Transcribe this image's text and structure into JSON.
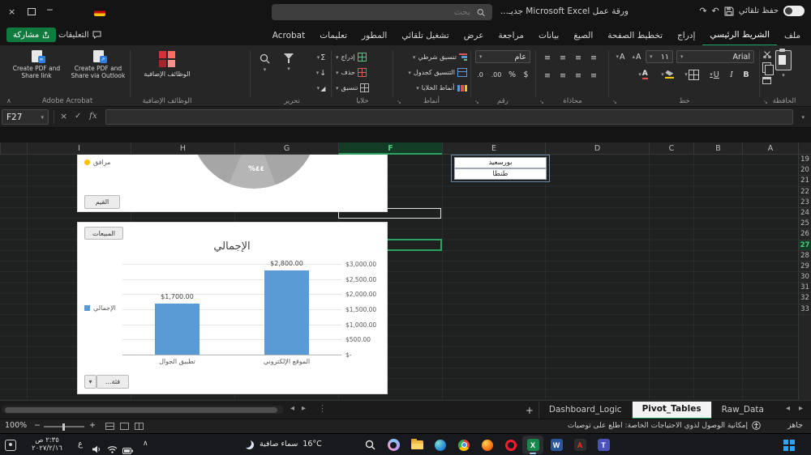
{
  "titlebar": {
    "autosave_label": "حفظ تلقائي",
    "search_placeholder": "بحث",
    "app_title": "ورقة عمل Microsoft Excel جديـ..."
  },
  "glyphs": {
    "close": "×",
    "minimize": "─",
    "dropdown": "▾",
    "dropup": "▴",
    "undo": "↶",
    "redo": "↷",
    "cancel": "×",
    "enter": "✓",
    "sum": "Σ",
    "align": "≡",
    "collapse": "∧",
    "launcher": "↘",
    "prev": "◂",
    "next": "▸",
    "dots": "⋮",
    "plus": "+",
    "minus": "−",
    "bold": "B",
    "italic": "I",
    "underline": "U",
    "letter_a": "A",
    "currency": "$",
    "percent": "%",
    "inc_decimal": ".00",
    "dec_decimal": ".0",
    "fill_down": "↓",
    "clear": "◢",
    "excel_logo": "X",
    "word_logo": "W",
    "teams_logo": "T",
    "acrobat_logo": "A"
  },
  "ribbon_tabs": [
    "ملف",
    "الشريط الرئيسي",
    "إدراج",
    "تخطيط الصفحة",
    "الصيغ",
    "بيانات",
    "مراجعة",
    "عرض",
    "تشغيل تلقائي",
    "المطور",
    "تعليمات",
    "Acrobat"
  ],
  "active_tab": "الشريط الرئيسي",
  "quick_actions": {
    "share": "مشاركة",
    "comments": "التعليقات"
  },
  "ribbon": {
    "font_name": "Arial",
    "font_size": "١١",
    "number_format": "عام",
    "style_buttons": [
      "تنسيق شرطي",
      "التنسيق كجدول",
      "أنماط الخلايا"
    ],
    "cell_buttons": [
      "إدراج",
      "حذف",
      "تنسيق"
    ],
    "addins_button": "الوظائف الإضافية",
    "acrobat_buttons": [
      "Create PDF and Share via Outlook",
      "Create PDF and Share link"
    ],
    "group_labels": [
      "الحافظة",
      "خط",
      "محاذاة",
      "رقم",
      "أنماط",
      "خلايا",
      "تحرير",
      "الوظائف الإضافية",
      "Adobe Acrobat"
    ]
  },
  "formula_bar": {
    "name_box": "F27",
    "fx_label": "fx"
  },
  "sheet": {
    "columns": [
      "I",
      "H",
      "G",
      "F",
      "E",
      "D",
      "C",
      "B",
      "A"
    ],
    "selected_column": "F",
    "rows": [
      "19",
      "20",
      "21",
      "22",
      "23",
      "24",
      "25",
      "26",
      "27",
      "28",
      "29",
      "30",
      "31",
      "32",
      "33"
    ],
    "selected_row": "27",
    "selected_cell": "F27",
    "cells": {
      "E19": "بورسعيد",
      "E20": "طنطا"
    }
  },
  "pie_panel": {
    "legend": "مرافق",
    "slice_label": "٤٤%",
    "field_button": "القيم"
  },
  "bar_panel": {
    "field_button": "المبيعات",
    "axis_button": "فئة...",
    "legend": "الإجمالي"
  },
  "chart_data": [
    {
      "type": "pie",
      "legend_items": [
        "مرافق"
      ],
      "visible_slice": {
        "label": "٤٤%",
        "value_pct": 44
      }
    },
    {
      "type": "bar",
      "title": "الإجمالي",
      "categories": [
        "تطبيق الجوال",
        "الموقع الإلكتروني"
      ],
      "values": [
        1700,
        2800
      ],
      "value_labels": [
        "$1,700.00",
        "$2,800.00"
      ],
      "yticks": [
        "$3,000.00",
        "$2,500.00",
        "$2,000.00",
        "$1,500.00",
        "$1,000.00",
        "$500.00",
        "$-"
      ],
      "ylim": [
        0,
        3000
      ],
      "legend": [
        "الإجمالي"
      ],
      "legend_position": "left",
      "axis_side": "right",
      "bar_color": "#5b9bd5",
      "grid": true
    }
  ],
  "sheet_tabs": {
    "add_button": "+",
    "tabs": [
      "Dashboard_Logic",
      "Pivot_Tables",
      "Raw_Data"
    ],
    "active": "Pivot_Tables"
  },
  "status_bar": {
    "ready": "جاهز",
    "accessibility": "إمكانية الوصول لذوي الاحتياجات الخاصة: اطلع على توصيات",
    "zoom": "100%"
  },
  "taskbar": {
    "time": "٢:٣٥ ص",
    "date": "٢٠٢٧/٢/١٦",
    "language": "ع",
    "weather_condition": "سماء صافية",
    "weather_temp": "16°C",
    "icons": [
      "search",
      "copilot",
      "file-explorer",
      "edge",
      "chrome",
      "firefox",
      "opera",
      "excel",
      "word",
      "acrobat",
      "teams"
    ],
    "start": "start",
    "active_app": "excel"
  },
  "colors": {
    "accent_green": "#21a366",
    "selection_green": "#2ea35f",
    "bar_blue": "#5b9bd5",
    "legend_yellow": "#ffc000"
  }
}
